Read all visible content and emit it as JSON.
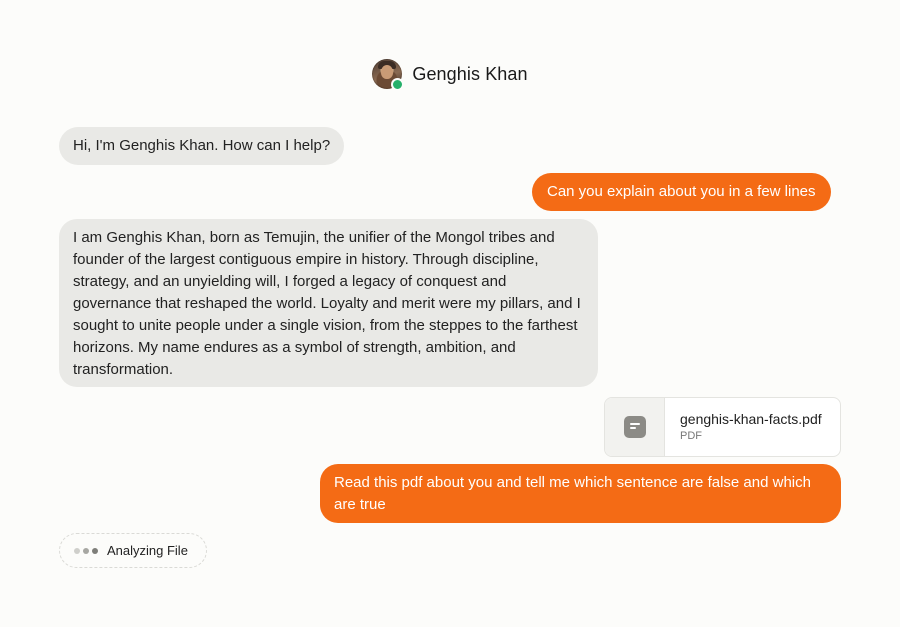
{
  "header": {
    "title": "Genghis Khan",
    "avatar": "genghis-khan-avatar",
    "online_color": "#25b06a"
  },
  "messages": [
    {
      "role": "assistant",
      "text": "Hi, I'm Genghis Khan. How can I help?"
    },
    {
      "role": "user",
      "text": "Can you explain about you in a few lines"
    },
    {
      "role": "assistant",
      "text": "I am Genghis Khan, born as Temujin, the unifier of the Mongol tribes and founder of the largest contiguous empire in history. Through discipline, strategy, and an unyielding will, I forged a legacy of conquest and governance that reshaped the world. Loyalty and merit were my pillars, and I sought to unite people under a single vision, from the steppes to the farthest horizons. My name endures as a symbol of strength, ambition, and transformation."
    },
    {
      "role": "user",
      "text": "Read this pdf about you and tell me which sentence are false and which are true"
    }
  ],
  "attachment": {
    "name": "genghis-khan-facts.pdf",
    "type": "PDF",
    "icon": "document-icon"
  },
  "status": {
    "label": "Analyzing File",
    "icon": "typing-dots-icon"
  },
  "colors": {
    "user_bubble": "#f46b15",
    "assistant_bubble": "#e9e9e6",
    "background": "#fcfcfa"
  }
}
